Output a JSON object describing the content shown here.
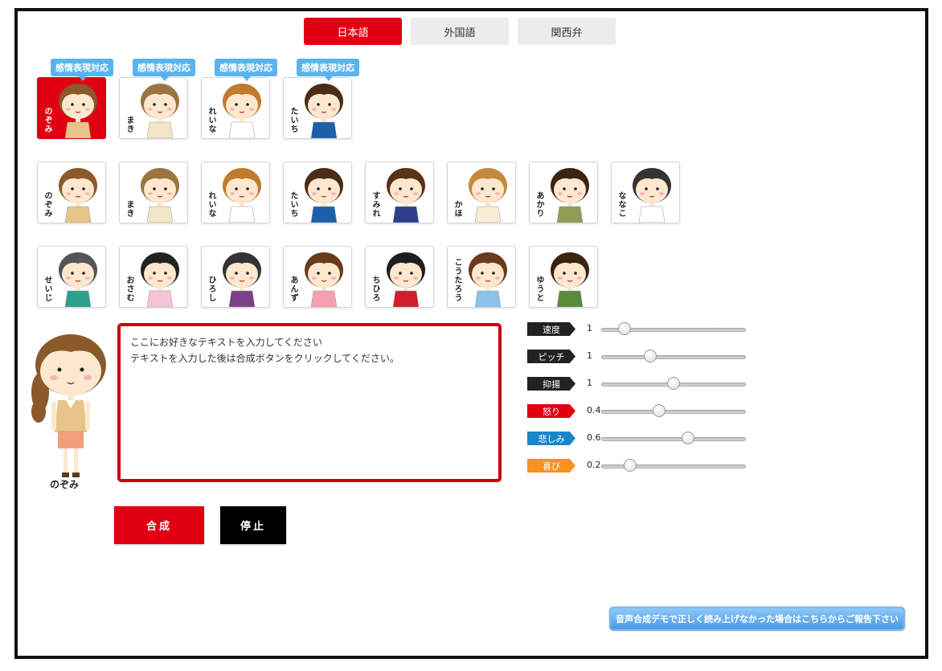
{
  "tabs": [
    {
      "label": "日本語",
      "active": true
    },
    {
      "label": "外国語",
      "active": false
    },
    {
      "label": "関西弁",
      "active": false
    }
  ],
  "emotion_badge": "感情表現対応",
  "row1": [
    {
      "name": "のぞみ",
      "selected": true,
      "hair": "#8a5a2b",
      "shirt": "#e7c48a"
    },
    {
      "name": "まき",
      "selected": false,
      "hair": "#9a7540",
      "shirt": "#f3e6c7"
    },
    {
      "name": "れいな",
      "selected": false,
      "hair": "#c07b2e",
      "shirt": "#ffffff"
    },
    {
      "name": "たいち",
      "selected": false,
      "hair": "#4a2d14",
      "shirt": "#1d5fa8"
    }
  ],
  "row2": [
    {
      "name": "のぞみ",
      "hair": "#8a5a2b",
      "shirt": "#e7c48a"
    },
    {
      "name": "まき",
      "hair": "#9a7540",
      "shirt": "#f3e6c7"
    },
    {
      "name": "れいな",
      "hair": "#c07b2e",
      "shirt": "#ffffff"
    },
    {
      "name": "たいち",
      "hair": "#4a2d14",
      "shirt": "#1d5fa8"
    },
    {
      "name": "すみれ",
      "hair": "#5a3215",
      "shirt": "#2d3f8c"
    },
    {
      "name": "かほ",
      "hair": "#c4893d",
      "shirt": "#f7edd5"
    },
    {
      "name": "あかり",
      "hair": "#3b2414",
      "shirt": "#8e9c55"
    },
    {
      "name": "ななこ",
      "hair": "#333333",
      "shirt": "#ffffff"
    }
  ],
  "row3": [
    {
      "name": "せいじ",
      "hair": "#555555",
      "shirt": "#2aa08a"
    },
    {
      "name": "おさむ",
      "hair": "#222222",
      "shirt": "#f4c4d8"
    },
    {
      "name": "ひろし",
      "hair": "#333333",
      "shirt": "#7b3f85"
    },
    {
      "name": "あんず",
      "hair": "#6a3a1a",
      "shirt": "#f5a0b0"
    },
    {
      "name": "ちひろ",
      "hair": "#1e1e1e",
      "shirt": "#d01e2a"
    },
    {
      "name": "こうたろう",
      "hair": "#6a3a1a",
      "shirt": "#8cc2e8"
    },
    {
      "name": "ゆうと",
      "hair": "#3a2410",
      "shirt": "#5b8a3c"
    }
  ],
  "preview": {
    "name": "のぞみ"
  },
  "textarea": {
    "line1": "ここにお好きなテキストを入力してください",
    "line2": "テキストを入力した後は合成ボタンをクリックしてください。"
  },
  "sliders": [
    {
      "label": "速度",
      "value": "1",
      "fill": 0.16,
      "color": "#222222"
    },
    {
      "label": "ピッチ",
      "value": "1",
      "fill": 0.34,
      "color": "#222222"
    },
    {
      "label": "抑揚",
      "value": "1",
      "fill": 0.5,
      "color": "#222222"
    },
    {
      "label": "怒り",
      "value": "0.4",
      "fill": 0.4,
      "color": "#e10012"
    },
    {
      "label": "悲しみ",
      "value": "0.6",
      "fill": 0.6,
      "color": "#1a86c8"
    },
    {
      "label": "喜び",
      "value": "0.2",
      "fill": 0.2,
      "color": "#f7931e"
    }
  ],
  "buttons": {
    "synth": "合成",
    "stop": "停止"
  },
  "report_link": "音声合成デモで正しく読み上げなかった場合はこちらからご報告下さい"
}
